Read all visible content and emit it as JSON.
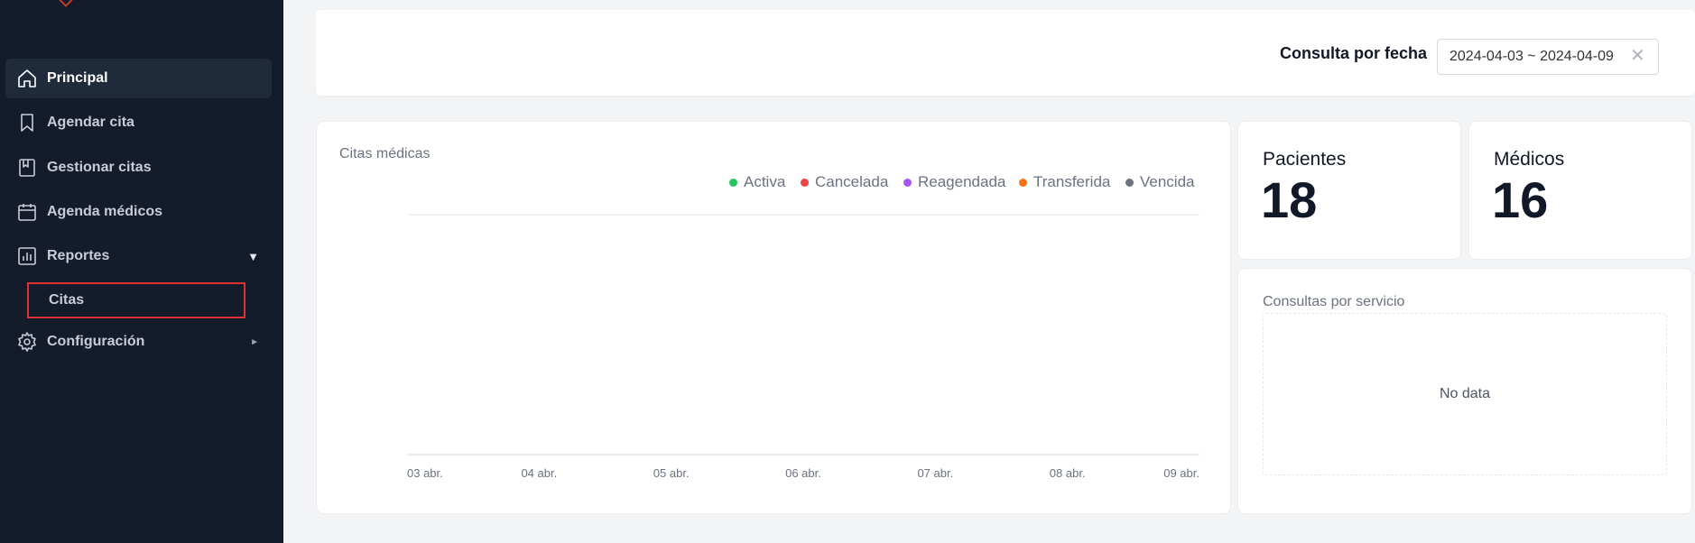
{
  "sidebar": {
    "items": [
      {
        "label": "Principal",
        "icon": "home-icon"
      },
      {
        "label": "Agendar cita",
        "icon": "bookmark-icon"
      },
      {
        "label": "Gestionar citas",
        "icon": "book-icon"
      },
      {
        "label": "Agenda médicos",
        "icon": "calendar-icon"
      },
      {
        "label": "Reportes",
        "icon": "bar-chart-icon",
        "arrow": "▼"
      },
      {
        "label": "Configuración",
        "icon": "gear-icon",
        "arrow": "►"
      }
    ],
    "subitems": [
      {
        "label": "Citas"
      }
    ]
  },
  "filter": {
    "label": "Consulta por fecha",
    "date_range": "2024-04-03 ~ 2024-04-09"
  },
  "chart_card": {
    "title": "Citas médicas"
  },
  "chart_data": {
    "type": "line",
    "title": "Citas médicas",
    "categories": [
      "03 abr.",
      "04 abr.",
      "05 abr.",
      "06 abr.",
      "07 abr.",
      "08 abr.",
      "09 abr."
    ],
    "series": [
      {
        "name": "Activa",
        "color": "#22c55e",
        "values": []
      },
      {
        "name": "Cancelada",
        "color": "#ef4444",
        "values": []
      },
      {
        "name": "Reagendada",
        "color": "#a855f7",
        "values": []
      },
      {
        "name": "Transferida",
        "color": "#f97316",
        "values": []
      },
      {
        "name": "Vencida",
        "color": "#6b7280",
        "values": []
      }
    ],
    "legend_position": "top-right",
    "grid": true
  },
  "stats": {
    "patients": {
      "label": "Pacientes",
      "value": "18"
    },
    "doctors": {
      "label": "Médicos",
      "value": "16"
    }
  },
  "service_card": {
    "title": "Consultas por servicio",
    "empty_text": "No data"
  },
  "colors": {
    "sidebar_bg": "#141b2b",
    "active_bg": "#1f2a3b",
    "highlight_border": "#e03131"
  }
}
